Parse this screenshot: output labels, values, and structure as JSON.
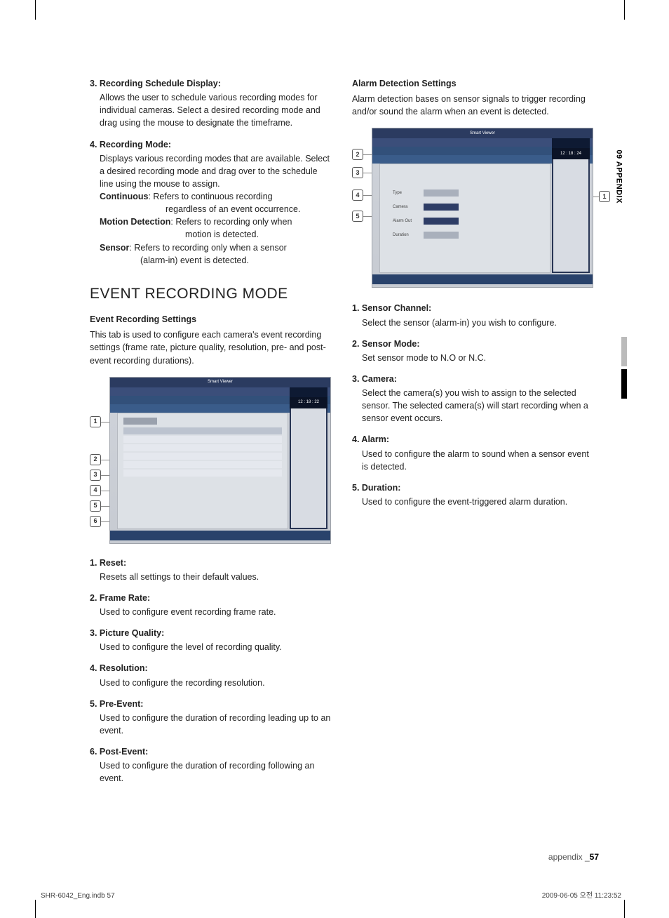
{
  "sideTab": "09 APPENDIX",
  "footer": {
    "label": "appendix _",
    "page": "57"
  },
  "printLeft": "SHR-6042_Eng.indb   57",
  "printRight": "2009-06-05   오전 11:23:52",
  "left": {
    "item3": {
      "title": "3. Recording Schedule Display:",
      "body": "Allows the user to schedule various recording modes for individual cameras. Select a desired recording mode and drag using the mouse to designate the timeframe."
    },
    "item4": {
      "title": "4. Recording Mode:",
      "body": "Displays various recording modes that are available. Select a desired recording mode and drag over to the schedule line using the mouse to assign.",
      "continuous": {
        "label": "Continuous",
        "desc1": ": Refers to continuous recording",
        "desc2": "regardless of an event occurrence."
      },
      "motion": {
        "label": "Motion Detection",
        "desc1": ": Refers to recording only when",
        "desc2": "motion is detected."
      },
      "sensor": {
        "label": "Sensor",
        "desc1": ": Refers to recording only when a sensor",
        "desc2": "(alarm-in) event is detected."
      }
    },
    "sectionTitle": "EVENT RECORDING MODE",
    "sub1": "Event Recording Settings",
    "sub1Body": "This tab is used to configure each camera's event recording settings (frame rate, picture quality, resolution, pre- and post-event recording durations).",
    "fig1": {
      "title": "Smart Viewer",
      "clock": "12 : 18 : 22",
      "callouts": [
        "1",
        "2",
        "3",
        "4",
        "5",
        "6"
      ]
    },
    "numbered": {
      "n1": {
        "t": "1. Reset:",
        "b": "Resets all settings to their default values."
      },
      "n2": {
        "t": "2. Frame Rate:",
        "b": "Used to configure event recording frame rate."
      },
      "n3": {
        "t": "3. Picture Quality:",
        "b": "Used to configure the level of recording quality."
      },
      "n4": {
        "t": "4. Resolution:",
        "b": "Used to configure the recording resolution."
      },
      "n5": {
        "t": "5. Pre-Event:",
        "b": "Used to configure the duration of recording leading up to an event."
      },
      "n6": {
        "t": "6. Post-Event:",
        "b": "Used to configure the duration of recording following an event."
      }
    }
  },
  "right": {
    "sub1": "Alarm Detection Settings",
    "sub1Body": "Alarm detection bases on sensor signals to trigger recording and/or sound the alarm when an event is detected.",
    "fig2": {
      "title": "Smart Viewer",
      "clock": "12 : 18 : 24",
      "calloutsLeft": [
        "2",
        "3",
        "4",
        "5"
      ],
      "calloutRight": "1"
    },
    "numbered": {
      "n1": {
        "t": "1. Sensor Channel:",
        "b": "Select the sensor (alarm-in) you wish to configure."
      },
      "n2": {
        "t": "2. Sensor Mode:",
        "b": "Set sensor mode to N.O or N.C."
      },
      "n3": {
        "t": "3. Camera:",
        "b": "Select the camera(s) you wish to assign to the selected sensor. The selected camera(s) will start recording when a sensor event occurs."
      },
      "n4": {
        "t": "4. Alarm:",
        "b": "Used to configure the alarm to sound when a sensor event is detected."
      },
      "n5": {
        "t": "5. Duration:",
        "b": "Used to configure the event-triggered alarm duration."
      }
    }
  }
}
